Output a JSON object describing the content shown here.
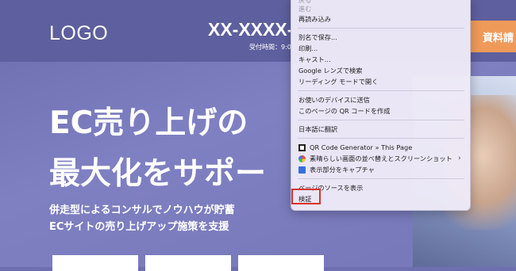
{
  "header": {
    "logo": "LOGO",
    "phone": "XX-XXXX-",
    "hours": "受付時間：9:0",
    "cta": "資料請"
  },
  "hero": {
    "line1": "EC売り上げの",
    "line2": "最大化をサポー",
    "sub1": "併走型によるコンサルでノウハウが貯蓄",
    "sub2": "ECサイトの売り上げアップ施策を支援"
  },
  "context_menu": {
    "items": [
      {
        "label": "戻る",
        "disabled": true
      },
      {
        "label": "進む",
        "disabled": true
      },
      {
        "label": "再読み込み",
        "disabled": false
      },
      {
        "label": "別名で保存...",
        "disabled": false
      },
      {
        "label": "印刷...",
        "disabled": false
      },
      {
        "label": "キャスト...",
        "disabled": false
      },
      {
        "label": "Google レンズで検索",
        "disabled": false
      },
      {
        "label": "リーディング モードで開く",
        "disabled": false
      },
      {
        "label": "お使いのデバイスに送信",
        "disabled": false
      },
      {
        "label": "このページの QR コードを作成",
        "disabled": false
      },
      {
        "label": "日本語に翻訳",
        "disabled": false
      },
      {
        "label": "QR Code Generator » This Page",
        "icon": "qr-code-icon"
      },
      {
        "label": "素晴らしい画面の並べ替えとスクリーンショット",
        "icon": "color-wheel-icon",
        "submenu": true
      },
      {
        "label": "表示部分をキャプチャ",
        "icon": "capture-icon"
      },
      {
        "label": "ページのソースを表示",
        "disabled": false
      },
      {
        "label": "検証",
        "disabled": false,
        "highlighted": true
      }
    ],
    "highlight_color": "#d9332b"
  }
}
